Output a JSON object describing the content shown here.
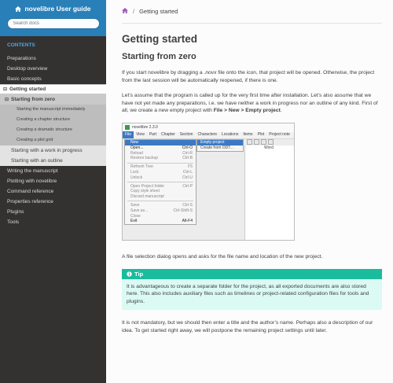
{
  "sidebar": {
    "brand": "novelibre User guide",
    "search_placeholder": "Search docs",
    "caption": "CONTENTS",
    "items": [
      {
        "label": "Preparations"
      },
      {
        "label": "Desktop overview"
      },
      {
        "label": "Basic concepts"
      },
      {
        "label": "Getting started"
      },
      {
        "label": "Starting from zero"
      },
      {
        "label": "Starting the manuscript immediately"
      },
      {
        "label": "Creating a chapter structure"
      },
      {
        "label": "Creating a dramatic structure"
      },
      {
        "label": "Creating a plot grid"
      },
      {
        "label": "Starting with a work in progress"
      },
      {
        "label": "Starting with an outline"
      },
      {
        "label": "Writing the manuscript"
      },
      {
        "label": "Plotting with novelibre"
      },
      {
        "label": "Command reference"
      },
      {
        "label": "Properties reference"
      },
      {
        "label": "Plugins"
      },
      {
        "label": "Tools"
      }
    ]
  },
  "breadcrumb": {
    "current": "Getting started",
    "separator": "/"
  },
  "content": {
    "h1": "Getting started",
    "h2": "Starting from zero",
    "p1": "If you start novelibre by dragging a .novx file onto the icon, that project will be opened. Otherwise, the project from the last session will be automatically reopened, if there is one.",
    "p2_a": "Let’s assume that the program is called up for the very first time after installation. Let’s also assume that we have not yet made any preparations, i.e. we have neither a work in progress nor an outline of any kind. First of all, we create a new empty project with ",
    "p2_b": "File > New > Empty project",
    "p2_c": ".",
    "p3": "A file selection dialog opens and asks for the file name and location of the new project.",
    "tip_title": "Tip",
    "tip_text": "It is advantageous to create a separate folder for the project, as all exported documents are also stored here. This also includes auxiliary files such as timelines or project-related configuration files for tools and plugins.",
    "p4": "It is not mandatory, but we should then enter a title and the author’s name. Perhaps also a description of our idea. To get started right away, we will postpone the remaining project settings until later."
  },
  "screenshot": {
    "title": "novelibre 2.3.0",
    "menus": [
      "File",
      "View",
      "Part",
      "Chapter",
      "Section",
      "Characters",
      "Locations",
      "Items",
      "Plot",
      "Project note"
    ],
    "word_label": "Word",
    "file_menu": [
      {
        "label": "New",
        "shortcut": "",
        "state": "hl"
      },
      {
        "label": "Open...",
        "shortcut": "Ctrl-O",
        "state": ""
      },
      {
        "label": "Reload",
        "shortcut": "Ctrl-R",
        "state": "dis"
      },
      {
        "label": "Restore backup",
        "shortcut": "Ctrl-B",
        "state": "dis"
      },
      {
        "sep": true
      },
      {
        "label": "Refresh Tree",
        "shortcut": "F5",
        "state": "dis"
      },
      {
        "label": "Lock",
        "shortcut": "Ctrl-L",
        "state": "dis"
      },
      {
        "label": "Unlock",
        "shortcut": "Ctrl-U",
        "state": "dis"
      },
      {
        "sep": true
      },
      {
        "label": "Open Project folder",
        "shortcut": "Ctrl-P",
        "state": "dis"
      },
      {
        "label": "Copy style sheet",
        "shortcut": "",
        "state": "dis"
      },
      {
        "label": "Discard manuscript",
        "shortcut": "",
        "state": "dis"
      },
      {
        "sep": true
      },
      {
        "label": "Save",
        "shortcut": "Ctrl-S",
        "state": "dis"
      },
      {
        "label": "Save as...",
        "shortcut": "Ctrl-Shift-S",
        "state": "dis"
      },
      {
        "label": "Close",
        "shortcut": "",
        "state": "dis"
      },
      {
        "label": "Exit",
        "shortcut": "Alt-F4",
        "state": ""
      }
    ],
    "new_submenu": [
      "Empty project",
      "Create from ODT..."
    ]
  },
  "colors": {
    "sidebar_bg": "#343131",
    "brand_bg": "#2980b9",
    "tip_title": "#1abc9c",
    "tip_bg": "#dbfaf4"
  }
}
